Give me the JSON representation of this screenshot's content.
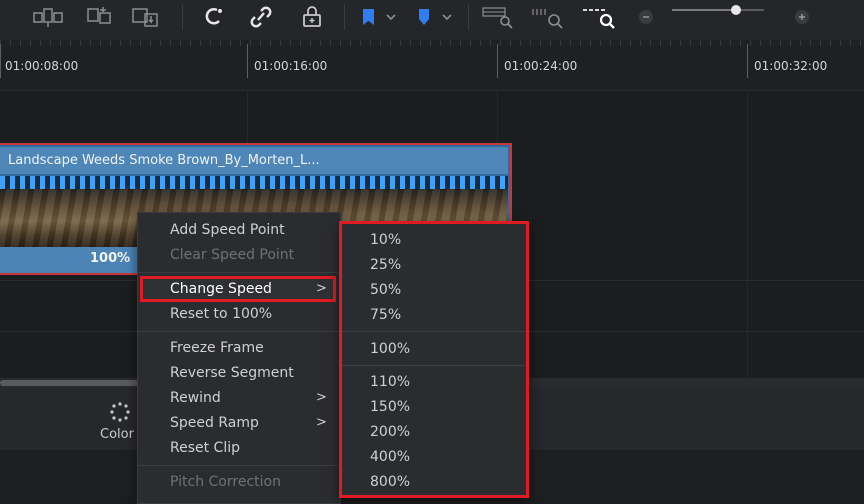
{
  "toolbar": {
    "icons": [
      "insert-clip-icon",
      "overwrite-clip-icon",
      "replace-clip-icon",
      "snapping-icon",
      "link-icon",
      "position-lock-icon",
      "flag-icon",
      "marker-icon",
      "zoom-full-icon",
      "zoom-detail-icon",
      "zoom-custom-icon",
      "zoom-out-icon",
      "zoom-in-icon"
    ],
    "zoom_level": 0.7
  },
  "ruler": {
    "timecodes": [
      "01:00:08:00",
      "01:00:16:00",
      "01:00:24:00",
      "01:00:32:00"
    ]
  },
  "clip": {
    "title": "Landscape Weeds Smoke Brown_By_Morten_L...",
    "speed": "100%"
  },
  "bottombar": {
    "color_label": "Color"
  },
  "menu": {
    "items": [
      {
        "label": "Add Speed Point"
      },
      {
        "label": "Clear Speed Point"
      },
      {
        "label": "Change Speed",
        "chevron": ">"
      },
      {
        "label": "Reset to 100%"
      },
      {
        "label": "Freeze Frame"
      },
      {
        "label": "Reverse Segment"
      },
      {
        "label": "Rewind",
        "chevron": ">"
      },
      {
        "label": "Speed Ramp",
        "chevron": ">"
      },
      {
        "label": "Reset Clip"
      },
      {
        "label": "Pitch Correction"
      }
    ]
  },
  "submenu": {
    "items": [
      "10%",
      "25%",
      "50%",
      "75%",
      "100%",
      "110%",
      "150%",
      "200%",
      "400%",
      "800%"
    ]
  },
  "colors": {
    "clip_blue": "#4f86b8",
    "highlight_red": "#e01b22",
    "marker_blue": "#2f7df0"
  }
}
